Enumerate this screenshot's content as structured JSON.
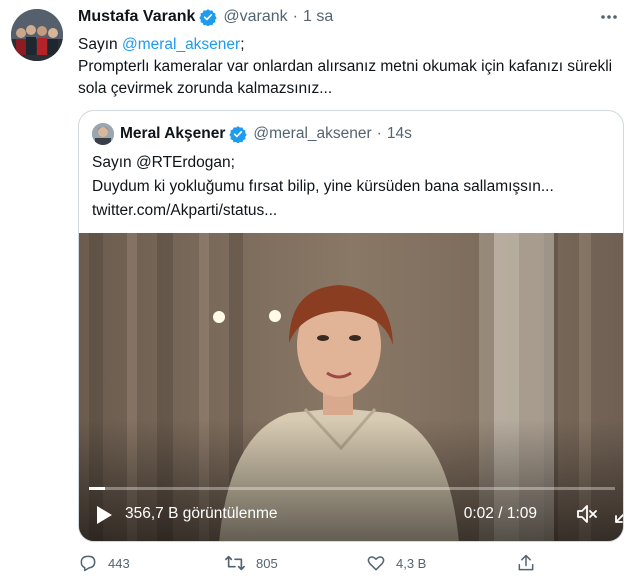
{
  "author": {
    "name": "Mustafa Varank",
    "handle": "@varank",
    "separator": "·",
    "time": "1 sa"
  },
  "tweet": {
    "greeting": "Sayın",
    "mention": "@meral_aksener",
    "greeting_end": ";",
    "body": "Prompterlı kameralar var onlardan alırsanız metni okumak için kafanızı sürekli sola çevirmek zorunda kalmazsınız..."
  },
  "quoted": {
    "name": "Meral Akşener",
    "handle": "@meral_aksener",
    "separator": "·",
    "time": "14s",
    "line1": "Sayın @RTErdogan;",
    "line2": "Duydum ki yokluğumu fırsat bilip, yine kürsüden bana sallamışsın...",
    "line3": "twitter.com/Akparti/status..."
  },
  "video": {
    "views": "356,7 B görüntülenme",
    "time": "0:02 / 1:09",
    "progress": 0.03
  },
  "actions": {
    "replies": "443",
    "retweets": "805",
    "likes": "4,3 B"
  },
  "colors": {
    "accent": "#1d9bf0",
    "muted": "#536471"
  }
}
